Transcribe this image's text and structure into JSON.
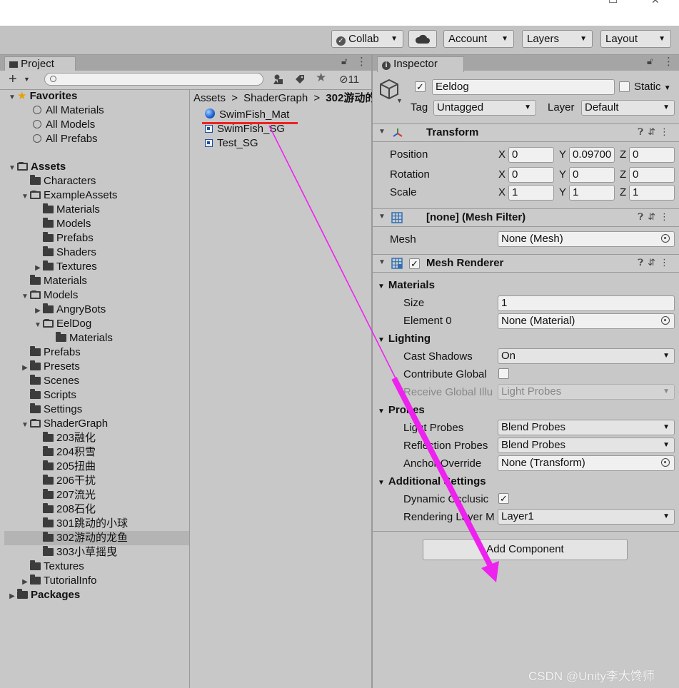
{
  "toolbar": {
    "collab": "Collab",
    "account": "Account",
    "layers": "Layers",
    "layout": "Layout"
  },
  "project": {
    "tab_label": "Project",
    "hidden_count": "11",
    "favorites": {
      "label": "Favorites",
      "items": [
        "All Materials",
        "All Models",
        "All Prefabs"
      ]
    },
    "tree": [
      {
        "label": "Assets",
        "depth": 0,
        "bold": true,
        "arrow": "down",
        "open": true
      },
      {
        "label": "Characters",
        "depth": 1,
        "arrow": "none"
      },
      {
        "label": "ExampleAssets",
        "depth": 1,
        "arrow": "down",
        "open": true
      },
      {
        "label": "Materials",
        "depth": 2,
        "arrow": "none"
      },
      {
        "label": "Models",
        "depth": 2,
        "arrow": "none"
      },
      {
        "label": "Prefabs",
        "depth": 2,
        "arrow": "none"
      },
      {
        "label": "Shaders",
        "depth": 2,
        "arrow": "none"
      },
      {
        "label": "Textures",
        "depth": 2,
        "arrow": "right"
      },
      {
        "label": "Materials",
        "depth": 1,
        "arrow": "none"
      },
      {
        "label": "Models",
        "depth": 1,
        "arrow": "down",
        "open": true
      },
      {
        "label": "AngryBots",
        "depth": 2,
        "arrow": "right"
      },
      {
        "label": "EelDog",
        "depth": 2,
        "arrow": "down",
        "open": true
      },
      {
        "label": "Materials",
        "depth": 3,
        "arrow": "none"
      },
      {
        "label": "Prefabs",
        "depth": 1,
        "arrow": "none"
      },
      {
        "label": "Presets",
        "depth": 1,
        "arrow": "right"
      },
      {
        "label": "Scenes",
        "depth": 1,
        "arrow": "none"
      },
      {
        "label": "Scripts",
        "depth": 1,
        "arrow": "none"
      },
      {
        "label": "Settings",
        "depth": 1,
        "arrow": "none"
      },
      {
        "label": "ShaderGraph",
        "depth": 1,
        "arrow": "down",
        "open": true
      },
      {
        "label": "203融化",
        "depth": 2,
        "arrow": "none"
      },
      {
        "label": "204积雪",
        "depth": 2,
        "arrow": "none"
      },
      {
        "label": "205扭曲",
        "depth": 2,
        "arrow": "none"
      },
      {
        "label": "206干扰",
        "depth": 2,
        "arrow": "none"
      },
      {
        "label": "207流光",
        "depth": 2,
        "arrow": "none"
      },
      {
        "label": "208石化",
        "depth": 2,
        "arrow": "none"
      },
      {
        "label": "301跳动的小球",
        "depth": 2,
        "arrow": "none"
      },
      {
        "label": "302游动的龙鱼",
        "depth": 2,
        "arrow": "none",
        "selected": true
      },
      {
        "label": "303小草摇曳",
        "depth": 2,
        "arrow": "none"
      },
      {
        "label": "Textures",
        "depth": 1,
        "arrow": "none"
      },
      {
        "label": "TutorialInfo",
        "depth": 1,
        "arrow": "right"
      },
      {
        "label": "Packages",
        "depth": 0,
        "bold": true,
        "arrow": "right"
      }
    ],
    "breadcrumb": [
      "Assets",
      "ShaderGraph",
      "302游动的"
    ],
    "files": [
      {
        "label": "SwimFish_Mat",
        "icon": "material-sphere-icon"
      },
      {
        "label": "SwimFish_SG",
        "icon": "shadergraph-icon"
      },
      {
        "label": "Test_SG",
        "icon": "shadergraph-icon"
      }
    ]
  },
  "inspector": {
    "tab_label": "Inspector",
    "object_name": "Eeldog",
    "static_label": "Static",
    "tag_label": "Tag",
    "tag_value": "Untagged",
    "layer_label": "Layer",
    "layer_value": "Default",
    "transform": {
      "title": "Transform",
      "position": {
        "label": "Position",
        "x": "0",
        "y": "0.09700",
        "z": "0"
      },
      "rotation": {
        "label": "Rotation",
        "x": "0",
        "y": "0",
        "z": "0"
      },
      "scale": {
        "label": "Scale",
        "x": "1",
        "y": "1",
        "z": "1"
      }
    },
    "mesh_filter": {
      "title": "[none] (Mesh Filter)",
      "mesh_label": "Mesh",
      "mesh_value": "None (Mesh)"
    },
    "mesh_renderer": {
      "title": "Mesh Renderer",
      "materials": "Materials",
      "size_label": "Size",
      "size_value": "1",
      "element0_label": "Element 0",
      "element0_value": "None (Material)",
      "lighting": "Lighting",
      "cast_shadows_label": "Cast Shadows",
      "cast_shadows_value": "On",
      "contribute_label": "Contribute Global",
      "receive_label": "Receive Global Illu",
      "receive_value": "Light Probes",
      "probes": "Probes",
      "light_probes_label": "Light Probes",
      "light_probes_value": "Blend Probes",
      "reflection_label": "Reflection Probes",
      "reflection_value": "Blend Probes",
      "anchor_label": "Anchor Override",
      "anchor_value": "None (Transform)",
      "additional": "Additional Settings",
      "dynamic_label": "Dynamic Occlusic",
      "rendering_layer_label": "Rendering Layer M",
      "rendering_layer_value": "Layer1"
    },
    "add_component": "Add Component"
  },
  "watermark": "CSDN @Unity李大馋师",
  "colors": {
    "annotation_arrow": "#ee22ee",
    "annotation_underline": "#ee2222",
    "selection": "#b4b4b4"
  }
}
